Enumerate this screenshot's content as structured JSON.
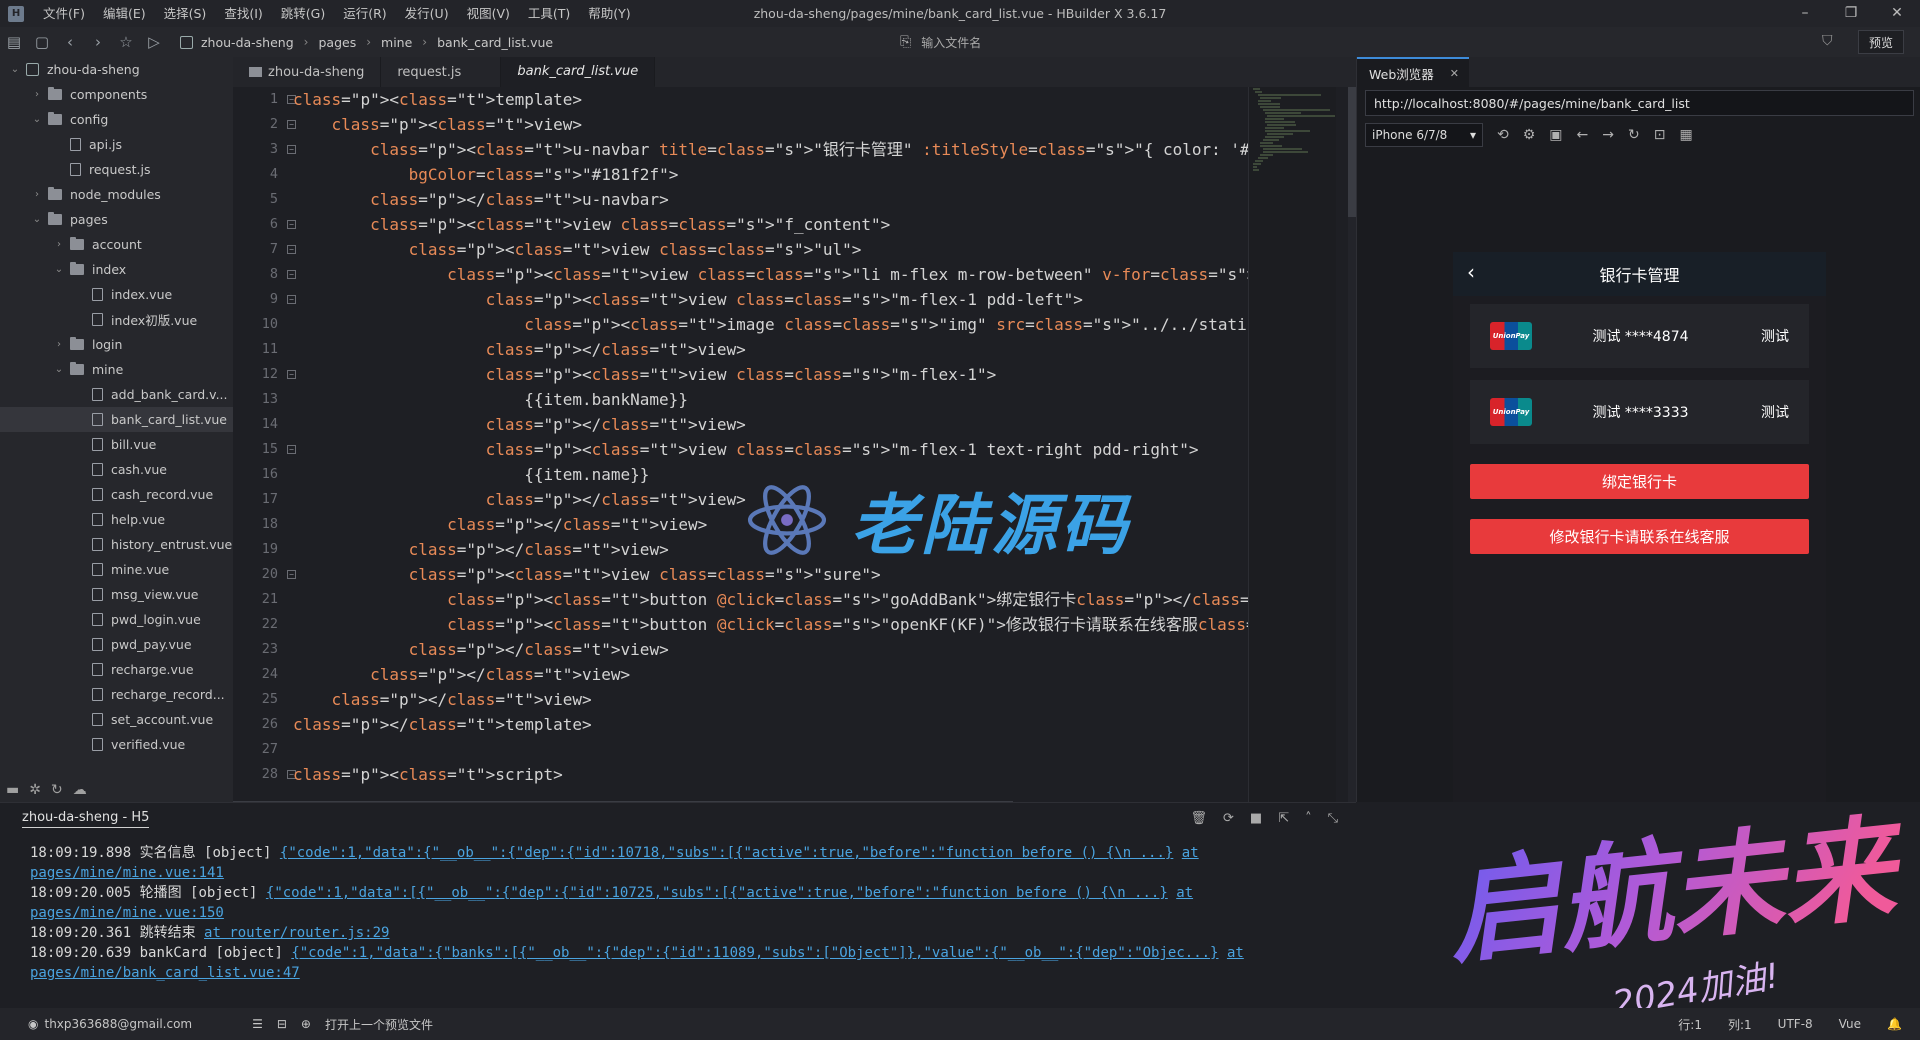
{
  "app": {
    "window_title": "zhou-da-sheng/pages/mine/bank_card_list.vue - HBuilder X 3.6.17",
    "menus": [
      "文件(F)",
      "编辑(E)",
      "选择(S)",
      "查找(I)",
      "跳转(G)",
      "运行(R)",
      "发行(U)",
      "视图(V)",
      "工具(T)",
      "帮助(Y)"
    ]
  },
  "toolbar": {
    "breadcrumb": [
      "zhou-da-sheng",
      "pages",
      "mine",
      "bank_card_list.vue"
    ],
    "file_input_placeholder": "输入文件名",
    "preview_label": "预览"
  },
  "sidebar": {
    "tree": [
      {
        "label": "zhou-da-sheng",
        "depth": 0,
        "kind": "project",
        "arrow": "v"
      },
      {
        "label": "components",
        "depth": 1,
        "kind": "folder",
        "arrow": ">"
      },
      {
        "label": "config",
        "depth": 1,
        "kind": "folder",
        "arrow": "v"
      },
      {
        "label": "api.js",
        "depth": 2,
        "kind": "file",
        "arrow": ""
      },
      {
        "label": "request.js",
        "depth": 2,
        "kind": "file",
        "arrow": ""
      },
      {
        "label": "node_modules",
        "depth": 1,
        "kind": "folder",
        "arrow": ">"
      },
      {
        "label": "pages",
        "depth": 1,
        "kind": "folder",
        "arrow": "v"
      },
      {
        "label": "account",
        "depth": 2,
        "kind": "folder",
        "arrow": ">"
      },
      {
        "label": "index",
        "depth": 2,
        "kind": "folder",
        "arrow": "v"
      },
      {
        "label": "index.vue",
        "depth": 3,
        "kind": "file",
        "arrow": ""
      },
      {
        "label": "index初版.vue",
        "depth": 3,
        "kind": "file",
        "arrow": ""
      },
      {
        "label": "login",
        "depth": 2,
        "kind": "folder",
        "arrow": ">"
      },
      {
        "label": "mine",
        "depth": 2,
        "kind": "folder",
        "arrow": "v"
      },
      {
        "label": "add_bank_card.v...",
        "depth": 3,
        "kind": "file",
        "arrow": ""
      },
      {
        "label": "bank_card_list.vue",
        "depth": 3,
        "kind": "file",
        "arrow": "",
        "selected": true
      },
      {
        "label": "bill.vue",
        "depth": 3,
        "kind": "file",
        "arrow": ""
      },
      {
        "label": "cash.vue",
        "depth": 3,
        "kind": "file",
        "arrow": ""
      },
      {
        "label": "cash_record.vue",
        "depth": 3,
        "kind": "file",
        "arrow": ""
      },
      {
        "label": "help.vue",
        "depth": 3,
        "kind": "file",
        "arrow": ""
      },
      {
        "label": "history_entrust.vue",
        "depth": 3,
        "kind": "file",
        "arrow": ""
      },
      {
        "label": "mine.vue",
        "depth": 3,
        "kind": "file",
        "arrow": ""
      },
      {
        "label": "msg_view.vue",
        "depth": 3,
        "kind": "file",
        "arrow": ""
      },
      {
        "label": "pwd_login.vue",
        "depth": 3,
        "kind": "file",
        "arrow": ""
      },
      {
        "label": "pwd_pay.vue",
        "depth": 3,
        "kind": "file",
        "arrow": ""
      },
      {
        "label": "recharge.vue",
        "depth": 3,
        "kind": "file",
        "arrow": ""
      },
      {
        "label": "recharge_record...",
        "depth": 3,
        "kind": "file",
        "arrow": ""
      },
      {
        "label": "set_account.vue",
        "depth": 3,
        "kind": "file",
        "arrow": ""
      },
      {
        "label": "verified.vue",
        "depth": 3,
        "kind": "file",
        "arrow": ""
      }
    ]
  },
  "editor": {
    "tabs": [
      {
        "label": "zhou-da-sheng",
        "active": false,
        "folder": true
      },
      {
        "label": "request.js",
        "active": false
      },
      {
        "label": "bank_card_list.vue",
        "active": true
      }
    ],
    "lines": [
      "<template>",
      "    <view>",
      "        <u-navbar title=\"银行卡管理\" :titleStyle=\"{ color: '#fff' }\" leftIconColor=\"#fff\" leftIc",
      "            bgColor=\"#181f2f\">",
      "        </u-navbar>",
      "        <view class=\"f_content\">",
      "            <view class=\"ul\">",
      "                <view class=\"li m-flex m-row-between\" v-for=\"(item,index) in banks\" :key=\"item.i",
      "                    <view class=\"m-flex-1 pdd-left\">",
      "                        <image class=\"img\" src=\"../../static/images/yinlian.png\" mode=\"\"></image",
      "                    </view>",
      "                    <view class=\"m-flex-1\">",
      "                        {{item.bankName}}",
      "                    </view>",
      "                    <view class=\"m-flex-1 text-right pdd-right\">",
      "                        {{item.name}}",
      "                    </view>",
      "                </view>",
      "            </view>",
      "            <view class=\"sure\">",
      "                <button @click=\"goAddBank\">绑定银行卡</button>",
      "                <button @click=\"openKF(KF)\">修改银行卡请联系在线客服</button>",
      "            </view>",
      "        </view>",
      "    </view>",
      "</template>",
      "",
      "<script>"
    ]
  },
  "browser": {
    "tab_label": "Web浏览器",
    "url": "http://localhost:8080/#/pages/mine/bank_card_list",
    "device": "iPhone 6/7/8",
    "page_title": "银行卡管理",
    "cards": [
      {
        "logo": "UnionPay 银联",
        "bank": "测试 ****4874",
        "owner": "测试"
      },
      {
        "logo": "UnionPay 银联",
        "bank": "测试 ****3333",
        "owner": "测试"
      }
    ],
    "bind_button": "绑定银行卡",
    "service_button": "修改银行卡请联系在线客服"
  },
  "console": {
    "title": "zhou-da-sheng - H5",
    "logs": [
      {
        "time": "18:09:19.898",
        "msg": "实名信息 [object]",
        "json": "{\"code\":1,\"data\":{\"__ob__\":{\"dep\":{\"id\":10718,\"subs\":[{\"active\":true,\"before\":\"function before () {\\n       ...}",
        "at": "at pages/mine/mine.vue:141"
      },
      {
        "time": "18:09:20.005",
        "msg": "轮播图 [object]",
        "json": "{\"code\":1,\"data\":[{\"__ob__\":{\"dep\":{\"id\":10725,\"subs\":[{\"active\":true,\"before\":\"function before () {\\n       ...}",
        "at": "at pages/mine/mine.vue:150"
      },
      {
        "time": "18:09:20.361",
        "msg": "跳转结束",
        "json": "",
        "at": "at router/router.js:29"
      },
      {
        "time": "18:09:20.639",
        "msg": "bankCard [object]",
        "json": "{\"code\":1,\"data\":{\"banks\":[{\"__ob__\":{\"dep\":{\"id\":11089,\"subs\":[\"Object\"]},\"value\":{\"__ob__\":{\"dep\":\"Objec...}",
        "at": "at pages/mine/bank_card_list.vue:47"
      }
    ]
  },
  "statusbar": {
    "user": "thxp363688@gmail.com",
    "open_prev": "打开上一个预览文件",
    "row": "行:1",
    "col": "列:1",
    "encoding": "UTF-8",
    "lang": "Vue"
  },
  "watermark": {
    "text": "老陆源码",
    "art_text": "启航未来",
    "art_sub": "2024加油!"
  },
  "colors": {
    "accent_red": "#e83a3c",
    "link_blue": "#4aa3df",
    "watermark_blue": "#3ba2e6"
  }
}
